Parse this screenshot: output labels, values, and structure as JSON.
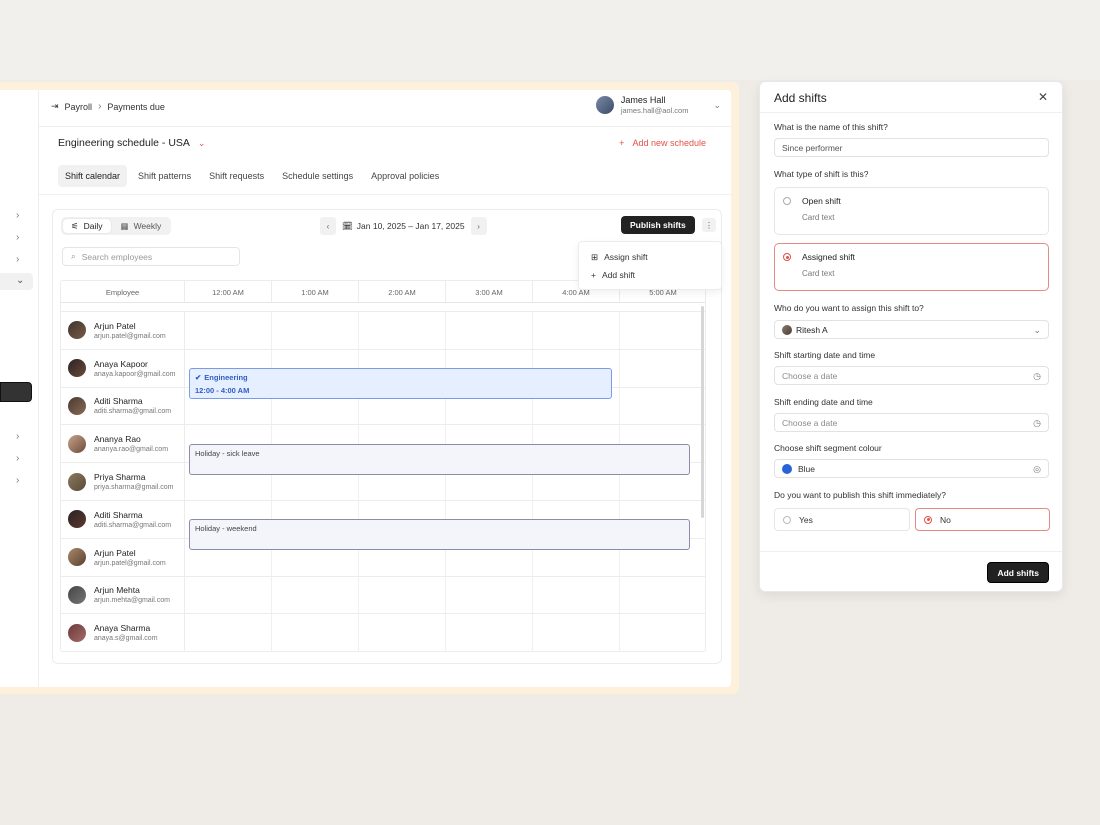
{
  "breadcrumb": {
    "parent": "Payroll",
    "current": "Payments due"
  },
  "user": {
    "name": "James Hall",
    "email": "james.hall@aol.com"
  },
  "schedule": {
    "title": "Engineering schedule - USA",
    "add_label": "Add new schedule"
  },
  "tabs": [
    {
      "label": "Shift calendar",
      "active": true
    },
    {
      "label": "Shift patterns"
    },
    {
      "label": "Shift requests"
    },
    {
      "label": "Schedule settings"
    },
    {
      "label": "Approval policies"
    }
  ],
  "toolbar": {
    "view_daily": "Daily",
    "view_weekly": "Weekly",
    "date_range": "Jan 10, 2025 – Jan 17, 2025",
    "publish_label": "Publish shifts",
    "search_placeholder": "Search employees"
  },
  "menu": {
    "assign": "Assign shift",
    "add": "Add shift"
  },
  "grid": {
    "employee_header": "Employee",
    "times": [
      "12:00 AM",
      "1:00 AM",
      "2:00 AM",
      "3:00 AM",
      "4:00 AM",
      "5:00 AM"
    ],
    "employees": [
      {
        "name": "Arjun Patel",
        "email": "arjun.patel@gmail.com"
      },
      {
        "name": "Anaya Kapoor",
        "email": "anaya.kapoor@gmail.com"
      },
      {
        "name": "Aditi Sharma",
        "email": "aditi.sharma@gmail.com"
      },
      {
        "name": "Ananya Rao",
        "email": "ananya.rao@gmail.com"
      },
      {
        "name": "Priya Sharma",
        "email": "priya.sharma@gmail.com"
      },
      {
        "name": "Aditi Sharma",
        "email": "aditi.sharma@gmail.com"
      },
      {
        "name": "Arjun Patel",
        "email": "arjun.patel@gmail.com"
      },
      {
        "name": "Arjun Mehta",
        "email": "arjun.mehta@gmail.com"
      },
      {
        "name": "Anaya Sharma",
        "email": "anaya.s@gmail.com"
      }
    ],
    "blocks": {
      "engineering": {
        "title": "Engineering",
        "time": "12:00 - 4:00 AM"
      },
      "sick": "Holiday - sick leave",
      "weekend": "Holiday - weekend"
    }
  },
  "drawer": {
    "title": "Add shifts",
    "q_name": "What is the name of this shift?",
    "name_value": "Since performer",
    "q_type": "What type of shift is this?",
    "open_title": "Open shift",
    "open_sub": "Card text",
    "assigned_title": "Assigned shift",
    "assigned_sub": "Card text",
    "q_assign": "Who do you want to assign this shift to?",
    "assignee": "Ritesh A",
    "q_start": "Shift starting date and time",
    "start_placeholder": "Choose a date",
    "q_end": "Shift ending date and time",
    "end_placeholder": "Choose a date",
    "q_colour": "Choose shift segment colour",
    "colour_value": "Blue",
    "q_publish": "Do you want to publish this shift immediately?",
    "yes": "Yes",
    "no": "No",
    "submit": "Add shifts"
  },
  "colors": {
    "accent": "#e0524a",
    "segment_blue": "#2a63d6",
    "dark_button": "#222222"
  }
}
